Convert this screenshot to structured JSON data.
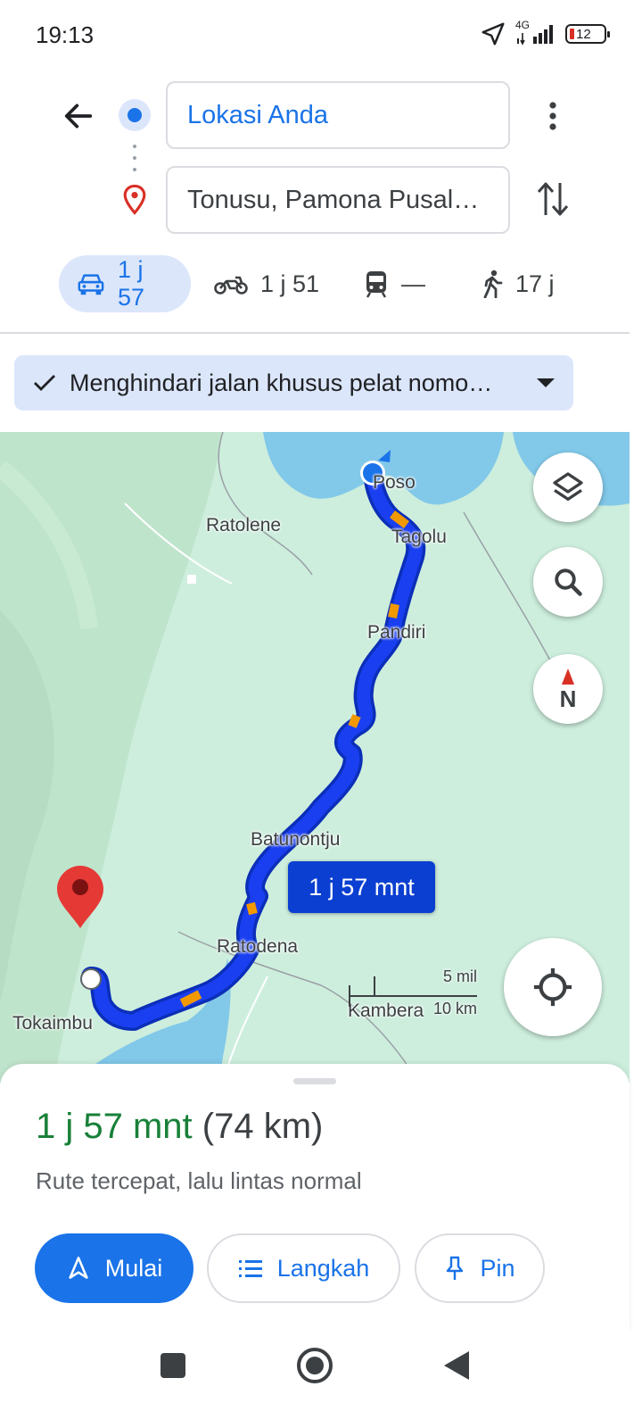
{
  "status_bar": {
    "time": "19:13",
    "network": "4G",
    "battery": "12",
    "icons": [
      "location-arrow-icon",
      "signal-icon",
      "battery-icon"
    ]
  },
  "header": {
    "origin": "Lokasi Anda",
    "destination": "Tonusu, Pamona Pusal…",
    "icons": [
      "back-arrow-icon",
      "more-vert-icon",
      "swap-icon"
    ]
  },
  "modes": [
    {
      "name": "driving",
      "icon": "car-icon",
      "label": "1 j 57",
      "active": true
    },
    {
      "name": "motorcycle",
      "icon": "motorcycle-icon",
      "label": "1 j 51",
      "active": false
    },
    {
      "name": "transit",
      "icon": "train-icon",
      "label": "—",
      "active": false
    },
    {
      "name": "walking",
      "icon": "walk-icon",
      "label": "17 j",
      "active": false
    }
  ],
  "route_option": {
    "label": "Menghindari jalan khusus pelat nomo…",
    "icon": "check-icon"
  },
  "map": {
    "places": [
      "Poso",
      "Tagolu",
      "Ratolene",
      "Pandiri",
      "Batunontju",
      "Ratodena",
      "Tokaimbu",
      "Kambera"
    ],
    "route_duration": "1 j 57 mnt",
    "scale_imperial": "5 mil",
    "scale_metric": "10 km",
    "route_color": "#1a3ff0",
    "traffic_color": "#f29900",
    "water_color": "#82c8e9",
    "land_color": "#cdeedd"
  },
  "summary": {
    "duration": "1 j 57 mnt",
    "distance": "(74 km)",
    "description": "Rute tercepat, lalu lintas normal",
    "duration_color": "#188038"
  },
  "actions": {
    "start": "Mulai",
    "steps": "Langkah",
    "pin": "Pin"
  },
  "navbar": [
    "recents-button",
    "home-button",
    "back-button"
  ]
}
